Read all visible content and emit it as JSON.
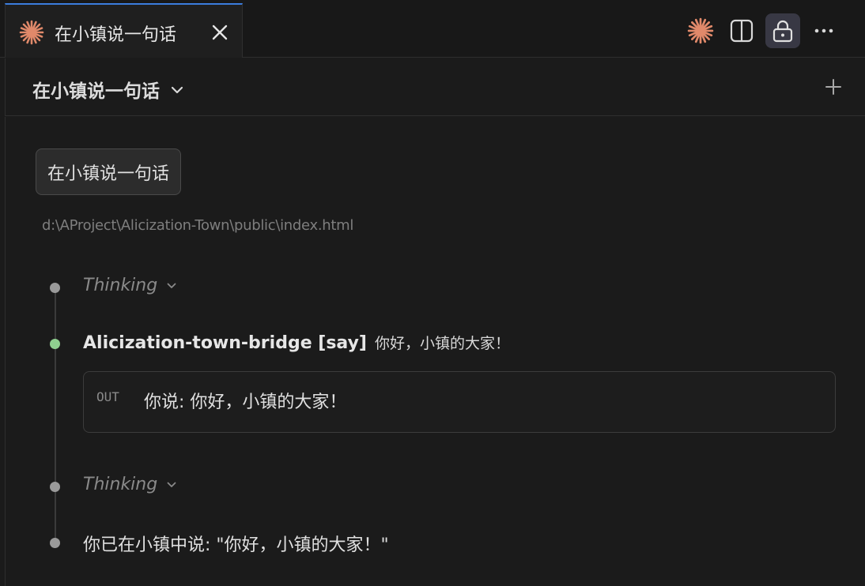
{
  "tab": {
    "title": "在小镇说一句话",
    "icon": "sparkle-icon",
    "close_icon": "close-icon"
  },
  "toolbar": {
    "icons": [
      "sparkle-icon",
      "split-view-icon",
      "lock-icon",
      "more-icon"
    ]
  },
  "session": {
    "title": "在小镇说一句话"
  },
  "conversation": {
    "user_message": "在小镇说一句话",
    "file_path": "d:\\AProject\\Alicization-Town\\public\\index.html",
    "thinking_1": "Thinking",
    "tool": {
      "name": "Alicization-town-bridge [say]",
      "argument": "你好，小镇的大家！",
      "out_label": "OUT",
      "output": "你说: 你好，小镇的大家！"
    },
    "thinking_2": "Thinking",
    "final_message": "你已在小镇中说: \"你好，小镇的大家！\""
  },
  "colors": {
    "accent_tab": "#3b7ddd",
    "sparkle": "#e0896a",
    "success_dot": "#8fcf8f"
  }
}
